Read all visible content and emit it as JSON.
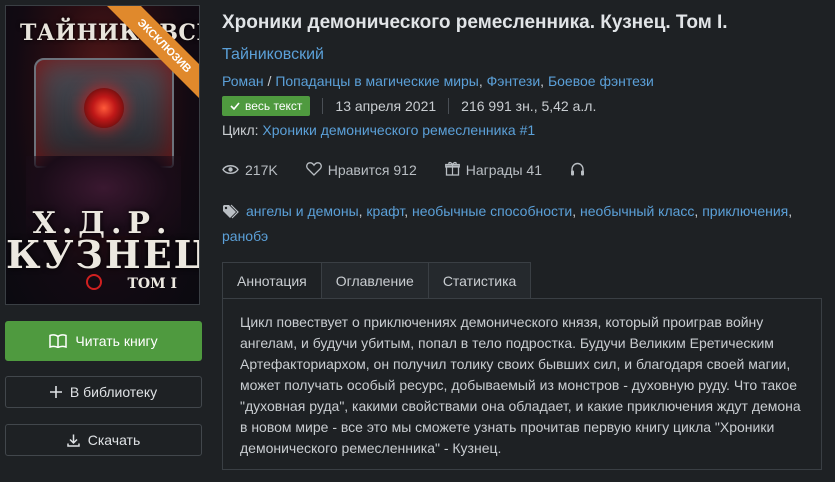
{
  "cover": {
    "author": "ТАЙНИКОВСКИЙ",
    "ribbon": "ЭКСКЛЮЗИВ",
    "initials": "Х.Д.Р.",
    "title": "КУЗНЕЦ",
    "volume": "ТОМ I"
  },
  "actions": {
    "read_label": "Читать книгу",
    "library_label": "В библиотеку",
    "download_label": "Скачать"
  },
  "book": {
    "title": "Хроники демонического ремесленника. Кузнец. Том I.",
    "author": "Тайниковский",
    "genres": [
      "Роман",
      "Попаданцы в магические миры",
      "Фэнтези",
      "Боевое фэнтези"
    ],
    "genre_separator": " / ",
    "status_badge": "весь текст",
    "date": "13 апреля 2021",
    "size": "216 991 зн., 5,42 а.л.",
    "cycle_label": "Цикл: ",
    "cycle_name": "Хроники демонического ремесленника #1"
  },
  "stats": {
    "views": "217K",
    "likes": "Нравится 912",
    "awards": "Награды 41"
  },
  "tags": [
    "ангелы и демоны",
    "крафт",
    "необычные способности",
    "необычный класс",
    "приключения",
    "ранобэ"
  ],
  "tabs": [
    {
      "label": "Аннотация",
      "active": true
    },
    {
      "label": "Оглавление",
      "active": false
    },
    {
      "label": "Статистика",
      "active": false
    }
  ],
  "annotation": "Цикл повествует о приключениях демонического князя, который проиграв войну ангелам, и будучи убитым, попал в тело подростка. Будучи Великим Еретическим Артефакториархом, он получил толику своих бывших сил, и благодаря своей магии, может получать особый ресурс, добываемый из монстров - духовную руду. Что такое \"духовная руда\", какими свойствами она обладает, и какие приключения ждут демона в новом мире - все это мы сможете узнать прочитав первую книгу цикла \"Хроники демонического ремесленника\" - Кузнец.",
  "colors": {
    "background": "#1e2124",
    "accent_green": "#4f9a3f",
    "link_blue": "#5ba0d8",
    "ribbon_orange": "#e0892c"
  },
  "icons": [
    "book-icon",
    "plus-icon",
    "download-icon",
    "check-icon",
    "eye-icon",
    "heart-icon",
    "gift-icon",
    "headphones-icon",
    "tag-icon"
  ]
}
